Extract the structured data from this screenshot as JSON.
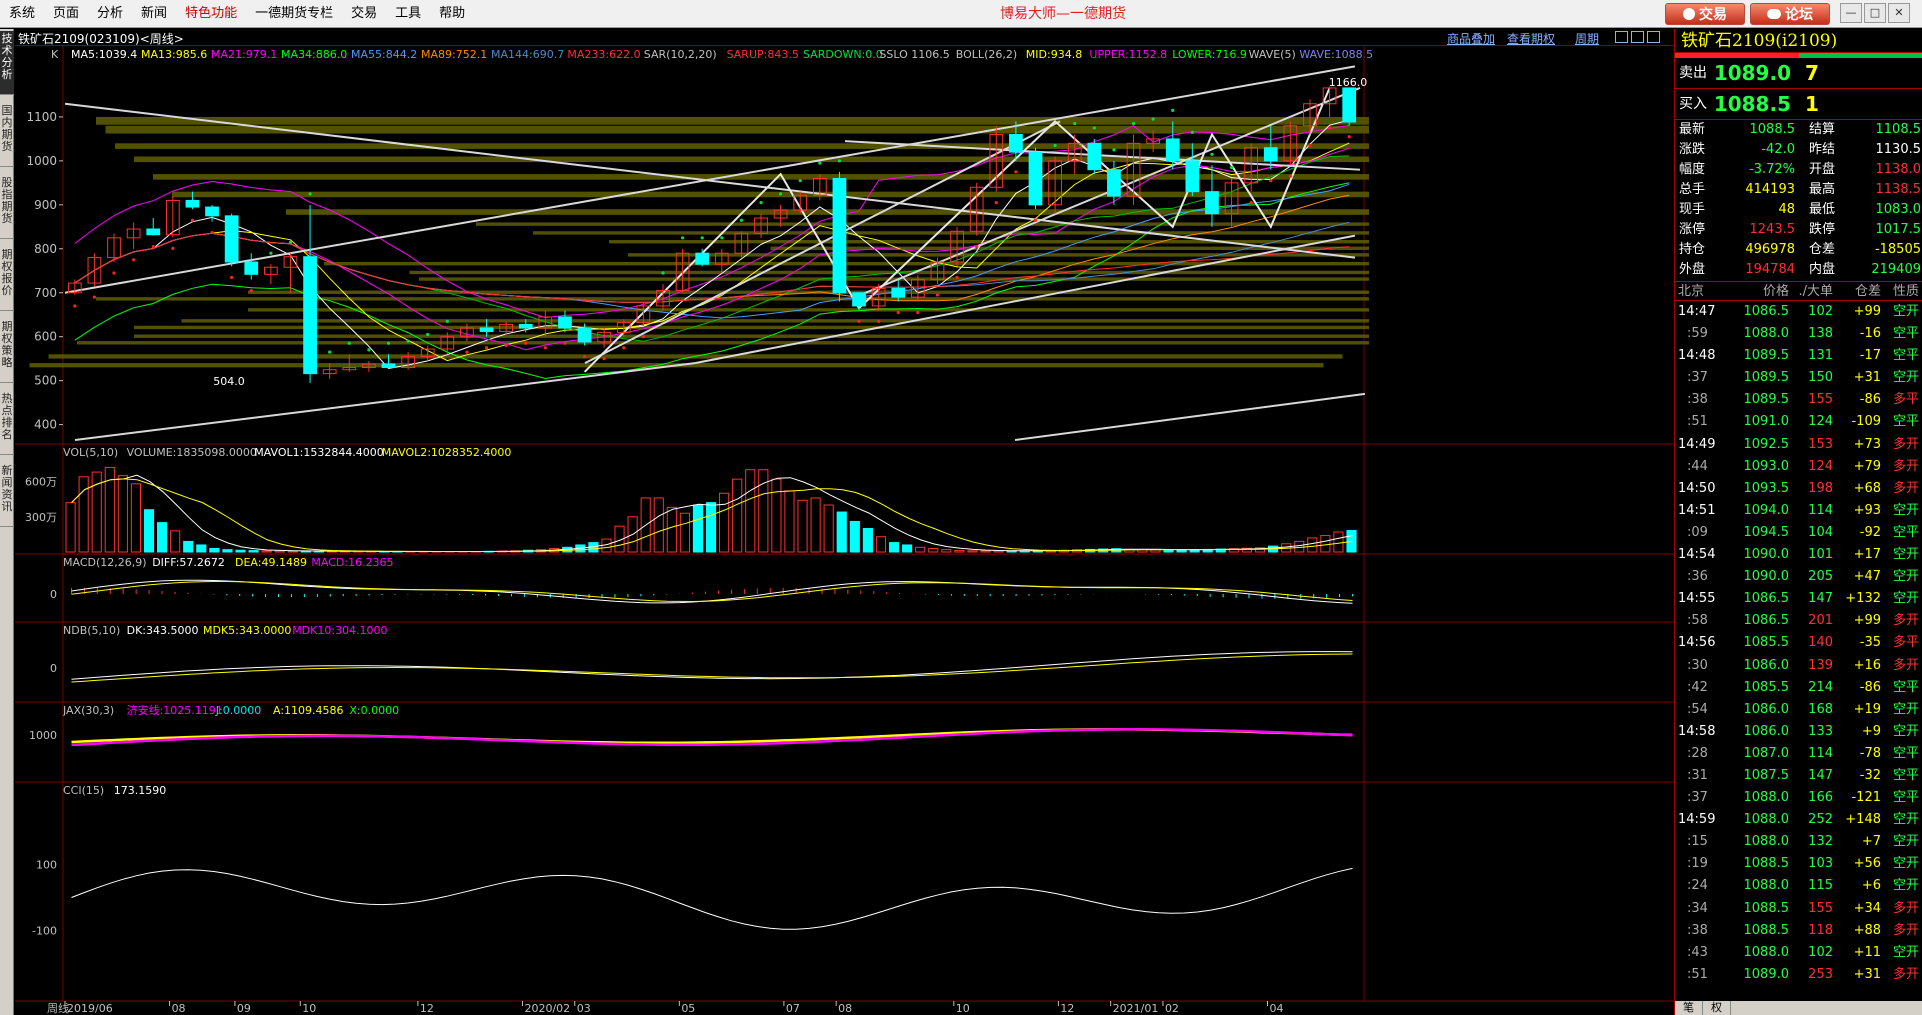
{
  "menu": {
    "items": [
      "系统",
      "页面",
      "分析",
      "新闻",
      "特色功能",
      "一德期货专栏",
      "交易",
      "工具",
      "帮助"
    ],
    "highlight_index": 4
  },
  "app_title": "博易大师—一德期货",
  "top_buttons": {
    "trade": "交易",
    "forum": "论坛"
  },
  "left_tabs": [
    "技术分析",
    "国内期货",
    "股指期货",
    "期权报价",
    "期权策略",
    "热点排名",
    "新闻资讯"
  ],
  "chart_header": {
    "instrument": "铁矿石2109(023109)<周线>",
    "links": [
      "商品叠加",
      "查看期权",
      "周期"
    ]
  },
  "colors": {
    "up": "#ff3030",
    "down": "#00ffff",
    "ma5": "#ffffff",
    "ma13": "#ffff00",
    "ma21": "#ff00ff",
    "ma34": "#00ff00",
    "ma55": "#4a9aff",
    "ma89": "#ff8800",
    "ma144": "#4a8ad0",
    "ma233": "#ff3030",
    "sar_up": "#ff2020",
    "sar_down": "#00e040",
    "band": "#6b6b00",
    "grid_border": "#800000"
  },
  "chart_data": [
    {
      "type": "candlestick",
      "title": "K",
      "indicator_text": [
        {
          "t": "MA5:1039.4",
          "c": "#ffffff"
        },
        {
          "t": "MA13:985.6",
          "c": "#ffff00"
        },
        {
          "t": "MA21:979.1",
          "c": "#ff00ff"
        },
        {
          "t": "MA34:886.0",
          "c": "#00ff00"
        },
        {
          "t": "MA55:844.2",
          "c": "#4a9aff"
        },
        {
          "t": "MA89:752.1",
          "c": "#ff8800"
        },
        {
          "t": "MA144:690.7",
          "c": "#4a8ad0"
        },
        {
          "t": "MA233:622.0",
          "c": "#ff3030"
        },
        {
          "t": "SAR(10,2,20)",
          "c": "#c0c0c0"
        },
        {
          "t": "SARUP:843.5",
          "c": "#ff3030"
        },
        {
          "t": "SARDOWN:0.0",
          "c": "#00e040"
        },
        {
          "t": "SSLO 1106.5",
          "c": "#c0c0c0"
        },
        {
          "t": "BOLL(26,2)",
          "c": "#c0c0c0"
        },
        {
          "t": "MID:934.8",
          "c": "#ffff00"
        },
        {
          "t": "UPPER:1152.8",
          "c": "#ff00ff"
        },
        {
          "t": "LOWER:716.9",
          "c": "#00ff00"
        },
        {
          "t": "WAVE(5)",
          "c": "#c0c0c0"
        },
        {
          "t": "WAVE:1088.5",
          "c": "#8080ff"
        }
      ],
      "yticks": [
        1100,
        1000,
        900,
        800,
        700,
        600,
        500,
        400
      ],
      "ylim": [
        365,
        1225
      ],
      "annotations": [
        {
          "label": "1166.0",
          "x_index": 66,
          "y": 1166
        },
        {
          "label": "504.0",
          "x_index": 9,
          "y": 504
        }
      ],
      "ohlc": [
        [
          700,
          730,
          695,
          722
        ],
        [
          722,
          790,
          715,
          780
        ],
        [
          780,
          835,
          770,
          825
        ],
        [
          825,
          860,
          800,
          845
        ],
        [
          845,
          870,
          830,
          832
        ],
        [
          832,
          920,
          826,
          910
        ],
        [
          910,
          930,
          890,
          895
        ],
        [
          895,
          900,
          862,
          875
        ],
        [
          875,
          880,
          760,
          770
        ],
        [
          770,
          790,
          730,
          742
        ],
        [
          742,
          765,
          720,
          758
        ],
        [
          758,
          790,
          700,
          782
        ],
        [
          782,
          900,
          495,
          516
        ],
        [
          516,
          540,
          504,
          525
        ],
        [
          525,
          560,
          520,
          530
        ],
        [
          530,
          545,
          520,
          538
        ],
        [
          538,
          560,
          528,
          530
        ],
        [
          530,
          565,
          525,
          555
        ],
        [
          555,
          580,
          545,
          572
        ],
        [
          572,
          610,
          560,
          600
        ],
        [
          600,
          630,
          590,
          620
        ],
        [
          620,
          640,
          600,
          612
        ],
        [
          612,
          635,
          605,
          628
        ],
        [
          628,
          640,
          610,
          620
        ],
        [
          620,
          660,
          600,
          645
        ],
        [
          645,
          660,
          610,
          620
        ],
        [
          620,
          630,
          580,
          588
        ],
        [
          588,
          620,
          575,
          610
        ],
        [
          610,
          640,
          600,
          632
        ],
        [
          632,
          680,
          625,
          670
        ],
        [
          670,
          720,
          660,
          705
        ],
        [
          705,
          800,
          700,
          790
        ],
        [
          790,
          800,
          760,
          765
        ],
        [
          765,
          800,
          745,
          790
        ],
        [
          790,
          840,
          780,
          835
        ],
        [
          835,
          880,
          825,
          870
        ],
        [
          870,
          900,
          850,
          888
        ],
        [
          888,
          930,
          880,
          922
        ],
        [
          922,
          970,
          910,
          960
        ],
        [
          960,
          975,
          680,
          700
        ],
        [
          700,
          700,
          660,
          670
        ],
        [
          670,
          720,
          660,
          710
        ],
        [
          710,
          730,
          680,
          690
        ],
        [
          690,
          740,
          680,
          730
        ],
        [
          730,
          780,
          720,
          770
        ],
        [
          770,
          850,
          760,
          840
        ],
        [
          840,
          950,
          830,
          940
        ],
        [
          940,
          1080,
          930,
          1060
        ],
        [
          1060,
          1090,
          1000,
          1020
        ],
        [
          1020,
          1030,
          890,
          900
        ],
        [
          900,
          1010,
          880,
          1000
        ],
        [
          1000,
          1060,
          970,
          1040
        ],
        [
          1040,
          1050,
          970,
          980
        ],
        [
          980,
          1000,
          900,
          920
        ],
        [
          920,
          1060,
          900,
          1040
        ],
        [
          1040,
          1070,
          1020,
          1050
        ],
        [
          1050,
          1090,
          980,
          1000
        ],
        [
          1000,
          1040,
          920,
          930
        ],
        [
          930,
          990,
          850,
          880
        ],
        [
          880,
          960,
          850,
          950
        ],
        [
          950,
          1040,
          930,
          1030
        ],
        [
          1030,
          1080,
          980,
          1000
        ],
        [
          1000,
          1090,
          990,
          1080
        ],
        [
          1080,
          1140,
          1060,
          1130
        ],
        [
          1130,
          1170,
          1100,
          1166
        ],
        [
          1166,
          1166,
          1080,
          1088.5
        ]
      ],
      "xticks": [
        {
          "i": 0,
          "label": "2019/06"
        },
        {
          "i": 8,
          "label": "08"
        },
        {
          "i": 13,
          "label": "09"
        },
        {
          "i": 18,
          "label": "10"
        },
        {
          "i": 27,
          "label": "12"
        },
        {
          "i": 35,
          "label": "2020/02"
        },
        {
          "i": 39,
          "label": "03"
        },
        {
          "i": 47,
          "label": "05"
        },
        {
          "i": 55,
          "label": "07"
        },
        {
          "i": 59,
          "label": "08"
        },
        {
          "i": 68,
          "label": "10"
        },
        {
          "i": 76,
          "label": "12"
        },
        {
          "i": 80,
          "label": "2021/01"
        },
        {
          "i": 84,
          "label": "02"
        },
        {
          "i": 92,
          "label": "04"
        }
      ],
      "xlabel_left": "周线"
    },
    {
      "type": "bar",
      "title": "VOL(5,10)",
      "indicator_text": [
        {
          "t": "VOL(5,10)",
          "c": "#c0c0c0"
        },
        {
          "t": "VOLUME:1835098.0000",
          "c": "#c0c0c0"
        },
        {
          "t": "MAVOL1:1532844.4000",
          "c": "#ffffff"
        },
        {
          "t": "MAVOL2:1028352.4000",
          "c": "#ffff00"
        }
      ],
      "yticks": [
        {
          "v": 600,
          "label": "600万"
        },
        {
          "v": 300,
          "label": "300万"
        }
      ],
      "ylim": [
        0,
        800
      ],
      "values": [
        420,
        640,
        680,
        720,
        650,
        580,
        360,
        250,
        180,
        90,
        60,
        30,
        20,
        15,
        12,
        10,
        10,
        8,
        8,
        6,
        5,
        5,
        5,
        4,
        4,
        4,
        4,
        4,
        4,
        4,
        4,
        4,
        6,
        8,
        10,
        15,
        20,
        30,
        40,
        60,
        80,
        110,
        220,
        300,
        460,
        460,
        380,
        330,
        400,
        420,
        500,
        620,
        700,
        700,
        620,
        520,
        440,
        460,
        400,
        340,
        260,
        200,
        130,
        80,
        60,
        40,
        30,
        20,
        12,
        10,
        10,
        10,
        10,
        10,
        12,
        12,
        15,
        20,
        22,
        25,
        28,
        22,
        20,
        18,
        18,
        20,
        20,
        22,
        25,
        28,
        32,
        36,
        50,
        70,
        90,
        120,
        140,
        170,
        183
      ]
    },
    {
      "type": "line",
      "title": "MACD(12,26,9)",
      "indicator_text": [
        {
          "t": "MACD(12,26,9)",
          "c": "#c0c0c0"
        },
        {
          "t": "DIFF:57.2672",
          "c": "#ffffff"
        },
        {
          "t": "DEA:49.1489",
          "c": "#ffff00"
        },
        {
          "t": "MACD:16.2365",
          "c": "#ff00ff"
        }
      ],
      "yticks": [
        0
      ],
      "ylim": [
        -40,
        40
      ]
    },
    {
      "type": "line",
      "title": "NDB(5,10)",
      "indicator_text": [
        {
          "t": "NDB(5,10)",
          "c": "#c0c0c0"
        },
        {
          "t": "DK:343.5000",
          "c": "#ffffff"
        },
        {
          "t": "MDK5:343.0000",
          "c": "#ffff00"
        },
        {
          "t": "MDK10:304.1000",
          "c": "#ff00ff"
        }
      ],
      "yticks": [
        0
      ],
      "ylim": [
        -400,
        400
      ]
    },
    {
      "type": "line",
      "title": "JAX(30,3)",
      "indicator_text": [
        {
          "t": "JAX(30,3)",
          "c": "#c0c0c0"
        },
        {
          "t": "济安线:1025.1191",
          "c": "#ff00ff"
        },
        {
          "t": "J:0.0000",
          "c": "#00e5e5"
        },
        {
          "t": "A:1109.4586",
          "c": "#ffff00"
        },
        {
          "t": "X:0.0000",
          "c": "#00ff00"
        }
      ],
      "yticks": [
        1000
      ],
      "ylim": [
        500,
        1200
      ]
    },
    {
      "type": "line",
      "title": "CCI(15)",
      "indicator_text": [
        {
          "t": "CCI(15)",
          "c": "#c0c0c0"
        },
        {
          "t": "173.1590",
          "c": "#ffffff"
        }
      ],
      "yticks": [
        100,
        -100
      ],
      "ylim": [
        -300,
        300
      ]
    }
  ],
  "quote": {
    "title": "铁矿石2109(i2109)",
    "sell_label": "卖出",
    "sell_price": "1089.0",
    "sell_vol": "7",
    "buy_label": "买入",
    "buy_price": "1088.5",
    "buy_vol": "1",
    "stats": [
      {
        "l": "最新",
        "v": "1088.5",
        "vc": "c-green",
        "l2": "结算",
        "v2": "1108.5",
        "v2c": "c-green"
      },
      {
        "l": "涨跌",
        "v": "-42.0",
        "vc": "c-green",
        "l2": "昨结",
        "v2": "1130.5",
        "v2c": "c-white"
      },
      {
        "l": "幅度",
        "v": "-3.72%",
        "vc": "c-green",
        "l2": "开盘",
        "v2": "1138.0",
        "v2c": "c-red"
      },
      {
        "l": "总手",
        "v": "414193",
        "vc": "c-yellow",
        "l2": "最高",
        "v2": "1138.5",
        "v2c": "c-red"
      },
      {
        "l": "现手",
        "v": "48",
        "vc": "c-yellow",
        "l2": "最低",
        "v2": "1083.0",
        "v2c": "c-green"
      },
      {
        "l": "涨停",
        "v": "1243.5",
        "vc": "c-red",
        "l2": "跌停",
        "v2": "1017.5",
        "v2c": "c-green"
      },
      {
        "l": "持仓",
        "v": "496978",
        "vc": "c-yellow",
        "l2": "仓差",
        "v2": "-18505",
        "v2c": "c-yellow"
      },
      {
        "l": "外盘",
        "v": "194784",
        "vc": "c-red",
        "l2": "内盘",
        "v2": "219409",
        "v2c": "c-green"
      }
    ],
    "tick_header": [
      "北京",
      "价格",
      "./大单",
      "仓差",
      "性质"
    ],
    "ticks": [
      {
        "time": "14:47",
        "price": "1086.5",
        "vol": "102",
        "oi": "+99",
        "nat": "空开",
        "main": true
      },
      {
        "time": ":59",
        "price": "1088.0",
        "vol": "138",
        "oi": "-16",
        "nat": "空平"
      },
      {
        "time": "14:48",
        "price": "1089.5",
        "vol": "131",
        "oi": "-17",
        "nat": "空平",
        "main": true
      },
      {
        "time": ":37",
        "price": "1089.5",
        "vol": "150",
        "oi": "+31",
        "nat": "空开"
      },
      {
        "time": ":38",
        "price": "1089.5",
        "vol": "155",
        "oi": "-86",
        "nat": "多平"
      },
      {
        "time": ":51",
        "price": "1091.0",
        "vol": "124",
        "oi": "-109",
        "nat": "空平"
      },
      {
        "time": "14:49",
        "price": "1092.5",
        "vol": "153",
        "oi": "+73",
        "nat": "多开",
        "main": true
      },
      {
        "time": ":44",
        "price": "1093.0",
        "vol": "124",
        "oi": "+79",
        "nat": "多开"
      },
      {
        "time": "14:50",
        "price": "1093.5",
        "vol": "198",
        "oi": "+68",
        "nat": "多开",
        "main": true
      },
      {
        "time": "14:51",
        "price": "1094.0",
        "vol": "114",
        "oi": "+93",
        "nat": "空开",
        "main": true
      },
      {
        "time": ":09",
        "price": "1094.5",
        "vol": "104",
        "oi": "-92",
        "nat": "空平"
      },
      {
        "time": "14:54",
        "price": "1090.0",
        "vol": "101",
        "oi": "+17",
        "nat": "空开",
        "main": true
      },
      {
        "time": ":36",
        "price": "1090.0",
        "vol": "205",
        "oi": "+47",
        "nat": "空开"
      },
      {
        "time": "14:55",
        "price": "1086.5",
        "vol": "147",
        "oi": "+132",
        "nat": "空开",
        "main": true
      },
      {
        "time": ":58",
        "price": "1086.5",
        "vol": "201",
        "oi": "+99",
        "nat": "多开"
      },
      {
        "time": "14:56",
        "price": "1085.5",
        "vol": "140",
        "oi": "-35",
        "nat": "多平",
        "main": true
      },
      {
        "time": ":30",
        "price": "1086.0",
        "vol": "139",
        "oi": "+16",
        "nat": "多开"
      },
      {
        "time": ":42",
        "price": "1085.5",
        "vol": "214",
        "oi": "-86",
        "nat": "空平"
      },
      {
        "time": ":54",
        "price": "1086.0",
        "vol": "168",
        "oi": "+19",
        "nat": "空开"
      },
      {
        "time": "14:58",
        "price": "1086.0",
        "vol": "133",
        "oi": "+9",
        "nat": "空开",
        "main": true
      },
      {
        "time": ":28",
        "price": "1087.0",
        "vol": "114",
        "oi": "-78",
        "nat": "空平"
      },
      {
        "time": ":31",
        "price": "1087.5",
        "vol": "147",
        "oi": "-32",
        "nat": "空平"
      },
      {
        "time": ":37",
        "price": "1088.0",
        "vol": "166",
        "oi": "-121",
        "nat": "空平"
      },
      {
        "time": "14:59",
        "price": "1088.0",
        "vol": "252",
        "oi": "+148",
        "nat": "空开",
        "main": true
      },
      {
        "time": ":15",
        "price": "1088.0",
        "vol": "132",
        "oi": "+7",
        "nat": "空开"
      },
      {
        "time": ":19",
        "price": "1088.5",
        "vol": "103",
        "oi": "+56",
        "nat": "空开"
      },
      {
        "time": ":24",
        "price": "1088.0",
        "vol": "115",
        "oi": "+6",
        "nat": "空开"
      },
      {
        "time": ":34",
        "price": "1088.5",
        "vol": "155",
        "oi": "+34",
        "nat": "多开"
      },
      {
        "time": ":38",
        "price": "1088.5",
        "vol": "118",
        "oi": "+88",
        "nat": "多开"
      },
      {
        "time": ":43",
        "price": "1088.0",
        "vol": "102",
        "oi": "+11",
        "nat": "空开"
      },
      {
        "time": ":51",
        "price": "1089.0",
        "vol": "253",
        "oi": "+31",
        "nat": "多开"
      }
    ],
    "bottom_tabs": [
      "笔",
      "权"
    ]
  }
}
